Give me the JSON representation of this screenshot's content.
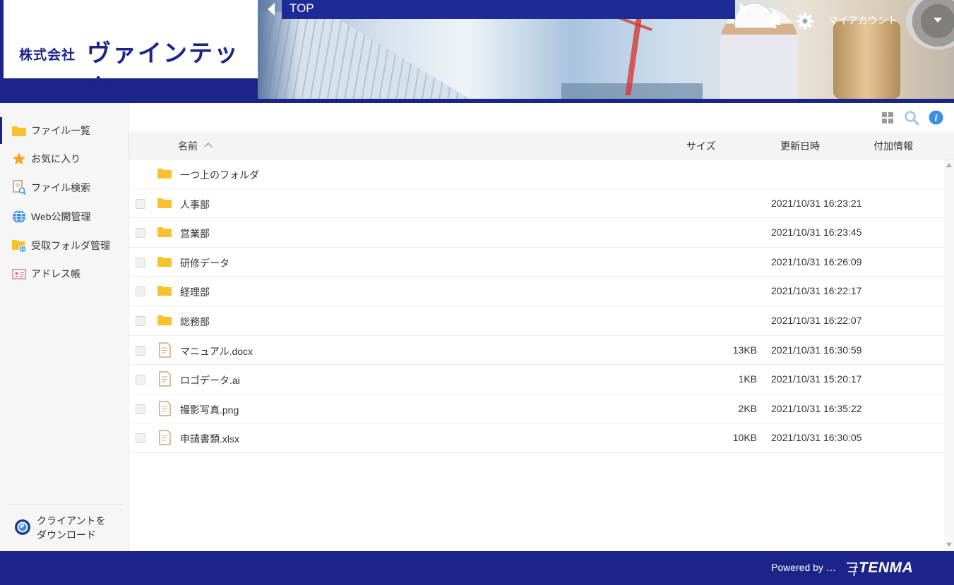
{
  "header": {
    "company_prefix": "株式会社",
    "company_name": "ヴァインテック",
    "breadcrumb": "TOP",
    "account_label": "マイアカウント"
  },
  "sidebar": {
    "items": [
      {
        "label": "ファイル一覧",
        "icon": "folder-icon"
      },
      {
        "label": "お気に入り",
        "icon": "star-icon"
      },
      {
        "label": "ファイル検索",
        "icon": "file-search-icon"
      },
      {
        "label": "Web公開管理",
        "icon": "globe-icon"
      },
      {
        "label": "受取フォルダ管理",
        "icon": "folder-globe-icon"
      },
      {
        "label": "アドレス帳",
        "icon": "address-card-icon"
      }
    ],
    "client_download_line1": "クライアントを",
    "client_download_line2": "ダウンロード"
  },
  "table": {
    "headers": {
      "name": "名前",
      "size": "サイズ",
      "date": "更新日時",
      "extra": "付加情報"
    },
    "parent_folder": "一つ上のフォルダ",
    "rows": [
      {
        "type": "folder",
        "name": "人事部",
        "size": "",
        "date": "2021/10/31 16:23:21"
      },
      {
        "type": "folder",
        "name": "営業部",
        "size": "",
        "date": "2021/10/31 16:23:45"
      },
      {
        "type": "folder",
        "name": "研修データ",
        "size": "",
        "date": "2021/10/31 16:26:09"
      },
      {
        "type": "folder",
        "name": "経理部",
        "size": "",
        "date": "2021/10/31 16:22:17"
      },
      {
        "type": "folder",
        "name": "総務部",
        "size": "",
        "date": "2021/10/31 16:22:07"
      },
      {
        "type": "file",
        "name": "マニュアル.docx",
        "size": "13KB",
        "date": "2021/10/31 16:30:59"
      },
      {
        "type": "file",
        "name": "ロゴデータ.ai",
        "size": "1KB",
        "date": "2021/10/31 15:20:17"
      },
      {
        "type": "file",
        "name": "撮影写真.png",
        "size": "2KB",
        "date": "2021/10/31 16:35:22"
      },
      {
        "type": "file",
        "name": "申請書類.xlsx",
        "size": "10KB",
        "date": "2021/10/31 16:30:05"
      }
    ]
  },
  "footer": {
    "powered_by": "Powered by …",
    "brand": "TENMA"
  },
  "colors": {
    "brand_navy": "#1b2589",
    "folder_yellow": "#f9c12e",
    "file_tan": "#c8a97c",
    "info_blue": "#3c8fe0"
  }
}
